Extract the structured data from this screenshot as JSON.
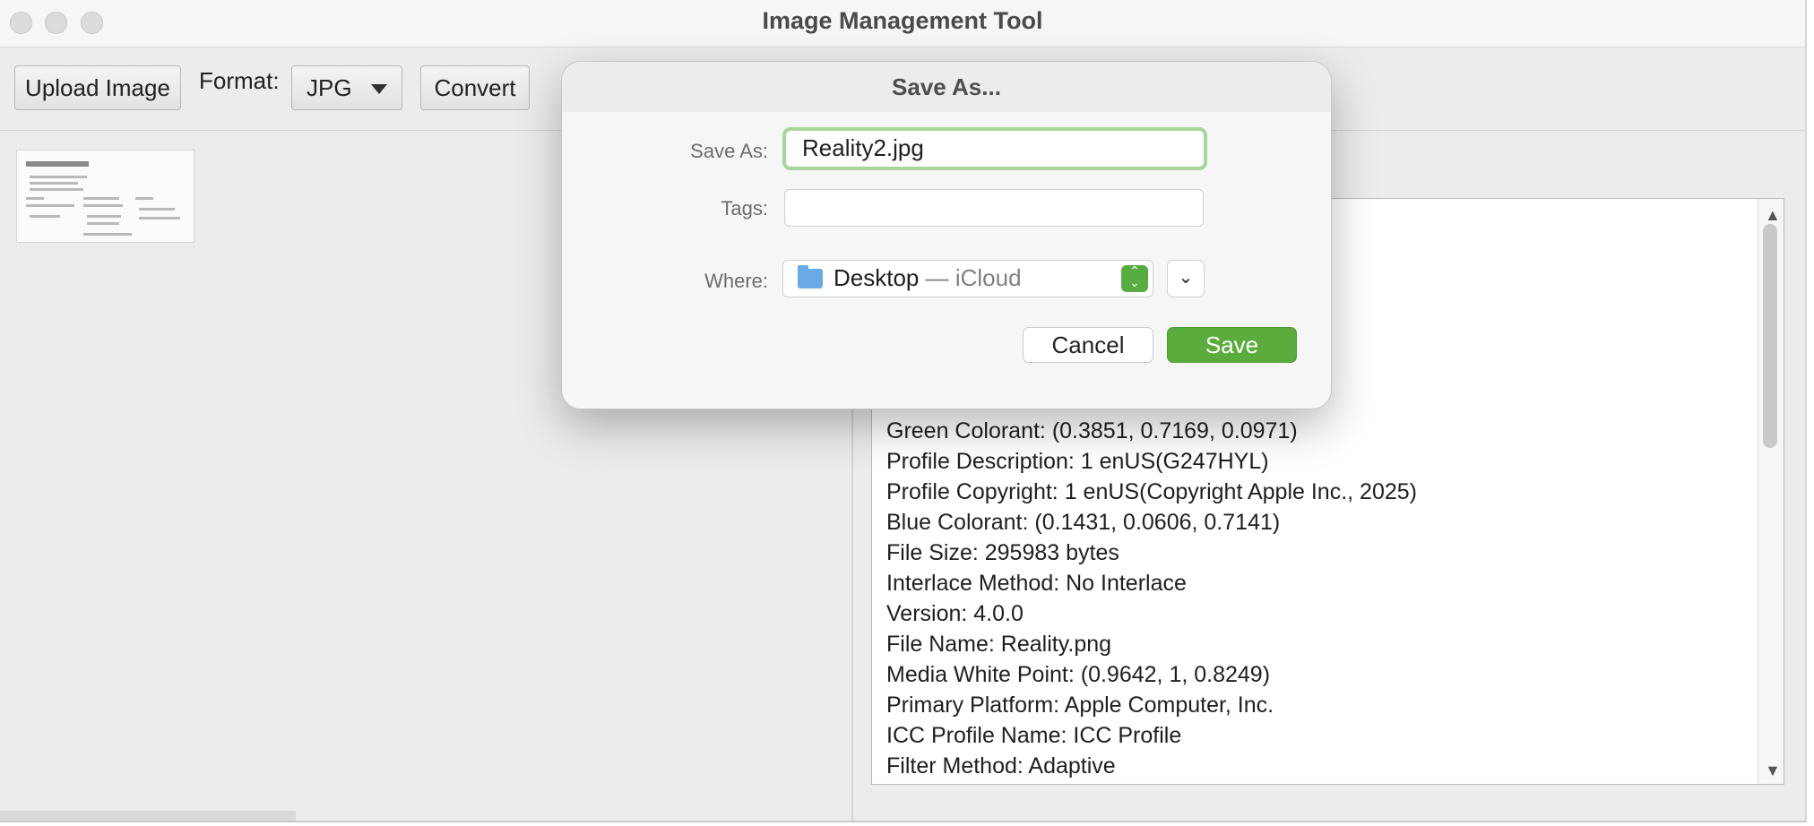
{
  "window": {
    "title": "Image Management Tool"
  },
  "toolbar": {
    "upload_label": "Upload Image",
    "format_label": "Format:",
    "format_value": "JPG",
    "convert_label": "Convert"
  },
  "metadata": {
    "lines": [
      "Green Colorant: (0.3851, 0.7169, 0.0971)",
      "Profile Description: 1 enUS(G247HYL)",
      "Profile Copyright: 1 enUS(Copyright Apple Inc., 2025)",
      "Blue Colorant: (0.1431, 0.0606, 0.7141)",
      "File Size: 295983 bytes",
      "Interlace Method: No Interlace",
      "Version: 4.0.0",
      "File Name: Reality.png",
      "Media White Point: (0.9642, 1, 0.8249)",
      "Primary Platform: Apple Computer, Inc.",
      "ICC Profile Name: ICC Profile",
      "Filter Method: Adaptive"
    ]
  },
  "dialog": {
    "title": "Save As...",
    "save_as_label": "Save As:",
    "save_as_value": "Reality2.jpg",
    "tags_label": "Tags:",
    "tags_value": "",
    "where_label": "Where:",
    "where_value": "Desktop",
    "where_sub": " — iCloud",
    "cancel_label": "Cancel",
    "save_label": "Save"
  },
  "icons": [
    "folder-icon",
    "chevron-down-icon",
    "updown-stepper-icon",
    "scroll-up-icon",
    "scroll-down-icon"
  ]
}
